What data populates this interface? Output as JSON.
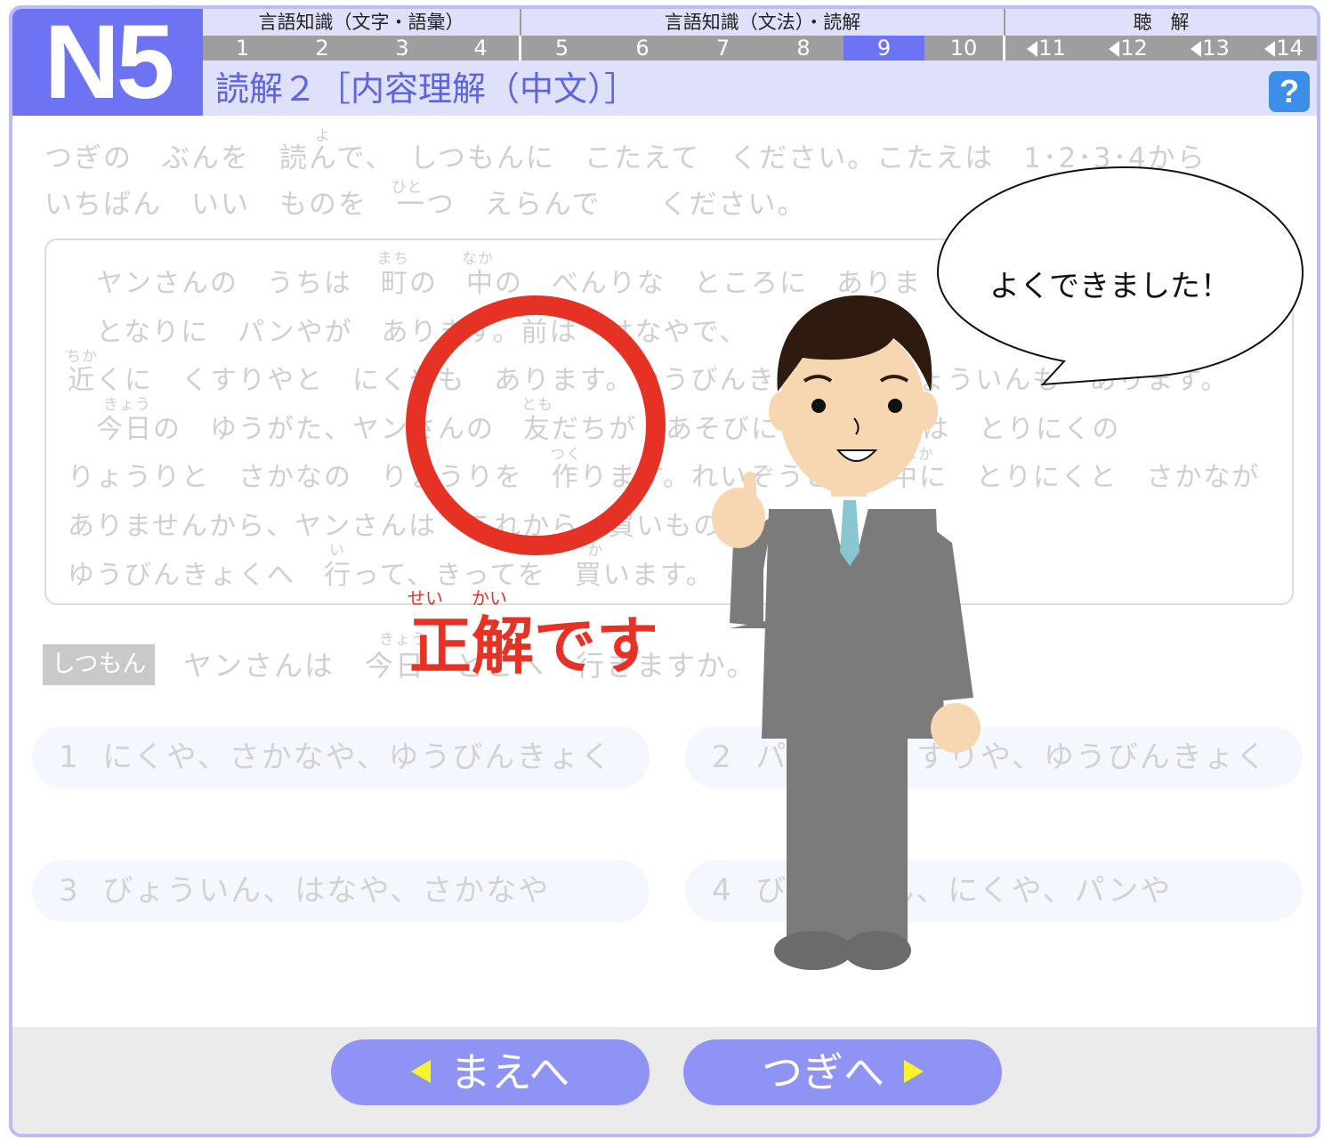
{
  "header": {
    "level": "N5",
    "categories": [
      {
        "label": "言語知識（文字・語彙）"
      },
      {
        "label": "言語知識（文法）・読解"
      },
      {
        "label": "聴　解"
      }
    ],
    "sections": [
      "1",
      "2",
      "3",
      "4",
      "5",
      "6",
      "7",
      "8",
      "9",
      "10",
      "11",
      "12",
      "13",
      "14"
    ],
    "active_section": "9",
    "title": "読解２［内容理解（中文）］",
    "help_label": "?"
  },
  "instruction": {
    "line1": "つぎの　ぶんを　読んで、　しつもんに　こたえて　ください。こたえは　1･2･3･4から",
    "line2": "いちばん　いい　ものを　一つ　えらんで　　ください。",
    "ruby_yo": "よ",
    "ruby_hito": "ひと"
  },
  "passage": {
    "lines": [
      "　ヤンさんの　うちは　町の　中の　べんりな　ところに　ありま",
      "　となりに　パンやが　あります。前は　はなやで、",
      "近くに　くすりやと　にくやも　あります。ゆうびんきょくと　びょういんも　あります。",
      "　今日の　ゆうがた、ヤンさんの　友だちが　あそびに　ヤンさんは　とりにくの",
      "りょうりと　さかなの　りょうりを　作ります。れいぞうこの　中に　とりにくと　さかなが",
      "ありませんから、ヤンさんは　これから　買いものに　それから、",
      "ゆうびんきょくへ　行って、きってを　買います。"
    ],
    "ruby": {
      "machi": "まち",
      "naka": "なか",
      "chika": "ちか",
      "kyou": "きょう",
      "tomo": "とも",
      "tsuku": "つく",
      "i": "い",
      "ka": "か",
      "naka2": "なか"
    }
  },
  "question": {
    "label": "しつもん",
    "text": "ヤンさんは　今日　どこへ　行きますか。",
    "ruby_kyou": "きょう"
  },
  "options": [
    {
      "num": "1",
      "text": "にくや、さかなや、ゆうびんきょく"
    },
    {
      "num": "2",
      "text": "パンや、くすりや、ゆうびんきょく"
    },
    {
      "num": "3",
      "text": "びょういん、はなや、さかなや"
    },
    {
      "num": "4",
      "text": "びょういん、にくや、パンや"
    }
  ],
  "feedback": {
    "result": "正解です",
    "ruby_sei": "せい",
    "ruby_kai": "かい",
    "speech": "よくできました！"
  },
  "nav": {
    "prev": "まえへ",
    "next": "つぎへ"
  },
  "colors": {
    "accent": "#6d73f2",
    "header_bg": "#dfe1fb",
    "correct_red": "#e53225",
    "nav_button": "#8f94f4",
    "arrow_yellow": "#f7f42a"
  }
}
